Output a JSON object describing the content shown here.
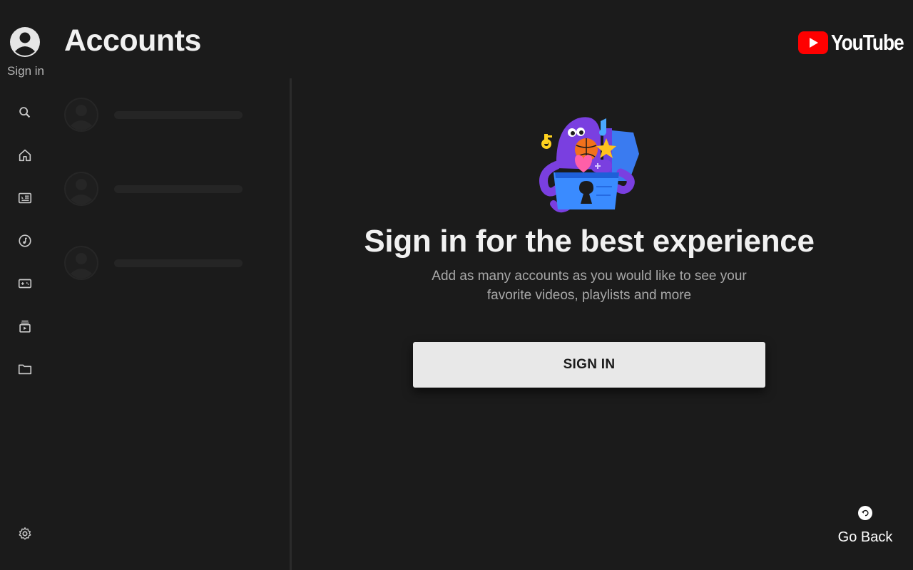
{
  "header": {
    "title": "Accounts",
    "logo_text": "YouTube",
    "brand_color": "#ff0000"
  },
  "rail": {
    "signin_label": "Sign in",
    "icons": [
      "search-icon",
      "home-icon",
      "subscriptions-icon",
      "music-icon",
      "gaming-icon",
      "library-icon",
      "folder-icon",
      "settings-icon"
    ]
  },
  "accounts": {
    "placeholder_count_note": "",
    "rows": [
      "placeholder",
      "placeholder",
      "placeholder"
    ]
  },
  "main": {
    "headline": "Sign in for the best experience",
    "subtext": "Add as many accounts as you would like to see your favorite videos, playlists and more",
    "signin_button": "SIGN IN"
  },
  "footer": {
    "go_back_label": "Go Back"
  }
}
